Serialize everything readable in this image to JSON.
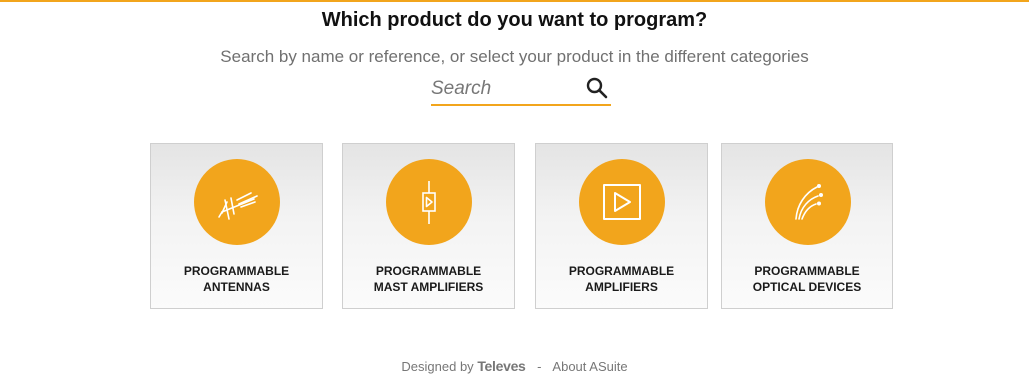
{
  "header": {
    "title": "Which product do you want to program?",
    "subtitle": "Search by name or reference, or select your product in the different categories",
    "accent_color": "#f2a51c"
  },
  "search": {
    "placeholder": "Search",
    "value": "",
    "icon": "search-icon"
  },
  "categories": [
    {
      "label": "PROGRAMMABLE\nANTENNAS",
      "icon": "antenna-icon"
    },
    {
      "label": "PROGRAMMABLE\nMAST AMPLIFIERS",
      "icon": "mast-amplifier-icon"
    },
    {
      "label": "PROGRAMMABLE\nAMPLIFIERS",
      "icon": "amplifier-icon"
    },
    {
      "label": "PROGRAMMABLE\nOPTICAL DEVICES",
      "icon": "optical-fiber-icon"
    }
  ],
  "footer": {
    "designed_by": "Designed by",
    "brand": "Televes",
    "separator": "-",
    "about": "About ASuite"
  }
}
